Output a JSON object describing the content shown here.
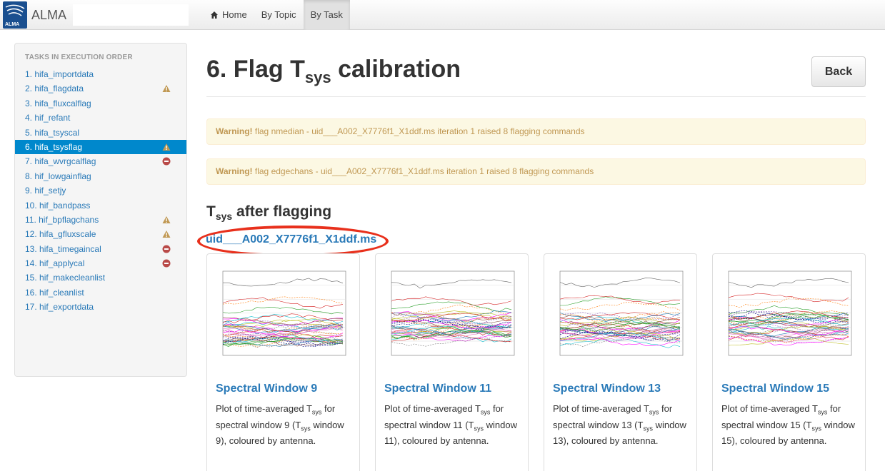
{
  "navbar": {
    "brand": "ALMA",
    "logo_caption": "ALMA",
    "items": [
      {
        "label": "Home",
        "icon": "home-icon"
      },
      {
        "label": "By Topic"
      },
      {
        "label": "By Task",
        "active": true
      }
    ]
  },
  "sidebar": {
    "header": "TASKS IN EXECUTION ORDER",
    "items": [
      {
        "label": "1. hifa_importdata",
        "status": ""
      },
      {
        "label": "2. hifa_flagdata",
        "status": "warning"
      },
      {
        "label": "3. hifa_fluxcalflag",
        "status": ""
      },
      {
        "label": "4. hif_refant",
        "status": ""
      },
      {
        "label": "5. hifa_tsyscal",
        "status": ""
      },
      {
        "label": "6. hifa_tsysflag",
        "status": "warning",
        "active": true
      },
      {
        "label": "7. hifa_wvrgcalflag",
        "status": "error"
      },
      {
        "label": "8. hif_lowgainflag",
        "status": ""
      },
      {
        "label": "9. hif_setjy",
        "status": ""
      },
      {
        "label": "10. hif_bandpass",
        "status": ""
      },
      {
        "label": "11. hif_bpflagchans",
        "status": "warning"
      },
      {
        "label": "12. hifa_gfluxscale",
        "status": "warning"
      },
      {
        "label": "13. hifa_timegaincal",
        "status": "error"
      },
      {
        "label": "14. hif_applycal",
        "status": "error"
      },
      {
        "label": "15. hif_makecleanlist",
        "status": ""
      },
      {
        "label": "16. hif_cleanlist",
        "status": ""
      },
      {
        "label": "17. hif_exportdata",
        "status": ""
      }
    ]
  },
  "main": {
    "title_prefix": "6. Flag T",
    "title_sub": "sys",
    "title_suffix": " calibration",
    "back_label": "Back",
    "alerts": [
      {
        "strong": "Warning!",
        "text": " flag nmedian - uid___A002_X7776f1_X1ddf.ms iteration 1 raised 8 flagging commands"
      },
      {
        "strong": "Warning!",
        "text": " flag edgechans - uid___A002_X7776f1_X1ddf.ms iteration 1 raised 8 flagging commands"
      }
    ],
    "section_prefix": "T",
    "section_sub": "sys",
    "section_suffix": " after flagging",
    "ms_link": "uid___A002_X7776f1_X1ddf.ms",
    "cards": [
      {
        "title": "Spectral Window 9",
        "d1": "Plot of time-averaged T",
        "d2": "sys",
        "d3": " for spectral window 9 (T",
        "d4": "sys",
        "d5": " window 9), coloured by antenna."
      },
      {
        "title": "Spectral Window 11",
        "d1": "Plot of time-averaged T",
        "d2": "sys",
        "d3": " for spectral window 11 (T",
        "d4": "sys",
        "d5": " window 11), coloured by antenna."
      },
      {
        "title": "Spectral Window 13",
        "d1": "Plot of time-averaged T",
        "d2": "sys",
        "d3": " for spectral window 13 (T",
        "d4": "sys",
        "d5": " window 13), coloured by antenna."
      },
      {
        "title": "Spectral Window 15",
        "d1": "Plot of time-averaged T",
        "d2": "sys",
        "d3": " for spectral window 15 (T",
        "d4": "sys",
        "d5": " window 15), coloured by antenna."
      }
    ]
  }
}
